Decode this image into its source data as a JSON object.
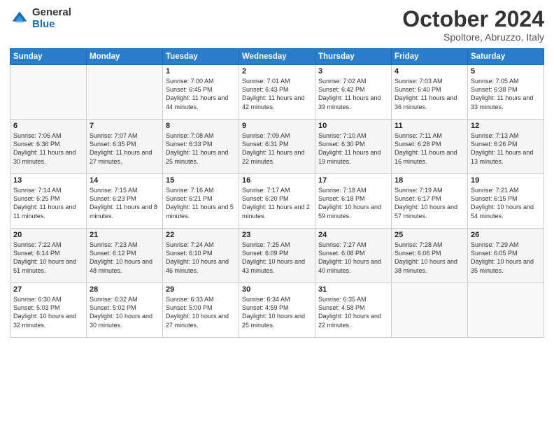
{
  "logo": {
    "general": "General",
    "blue": "Blue"
  },
  "header": {
    "month": "October 2024",
    "location": "Spoltore, Abruzzo, Italy"
  },
  "weekdays": [
    "Sunday",
    "Monday",
    "Tuesday",
    "Wednesday",
    "Thursday",
    "Friday",
    "Saturday"
  ],
  "weeks": [
    [
      {
        "day": "",
        "info": ""
      },
      {
        "day": "",
        "info": ""
      },
      {
        "day": "1",
        "info": "Sunrise: 7:00 AM\nSunset: 6:45 PM\nDaylight: 11 hours and 44 minutes."
      },
      {
        "day": "2",
        "info": "Sunrise: 7:01 AM\nSunset: 6:43 PM\nDaylight: 11 hours and 42 minutes."
      },
      {
        "day": "3",
        "info": "Sunrise: 7:02 AM\nSunset: 6:42 PM\nDaylight: 11 hours and 39 minutes."
      },
      {
        "day": "4",
        "info": "Sunrise: 7:03 AM\nSunset: 6:40 PM\nDaylight: 11 hours and 36 minutes."
      },
      {
        "day": "5",
        "info": "Sunrise: 7:05 AM\nSunset: 6:38 PM\nDaylight: 11 hours and 33 minutes."
      }
    ],
    [
      {
        "day": "6",
        "info": "Sunrise: 7:06 AM\nSunset: 6:36 PM\nDaylight: 11 hours and 30 minutes."
      },
      {
        "day": "7",
        "info": "Sunrise: 7:07 AM\nSunset: 6:35 PM\nDaylight: 11 hours and 27 minutes."
      },
      {
        "day": "8",
        "info": "Sunrise: 7:08 AM\nSunset: 6:33 PM\nDaylight: 11 hours and 25 minutes."
      },
      {
        "day": "9",
        "info": "Sunrise: 7:09 AM\nSunset: 6:31 PM\nDaylight: 11 hours and 22 minutes."
      },
      {
        "day": "10",
        "info": "Sunrise: 7:10 AM\nSunset: 6:30 PM\nDaylight: 11 hours and 19 minutes."
      },
      {
        "day": "11",
        "info": "Sunrise: 7:11 AM\nSunset: 6:28 PM\nDaylight: 11 hours and 16 minutes."
      },
      {
        "day": "12",
        "info": "Sunrise: 7:13 AM\nSunset: 6:26 PM\nDaylight: 11 hours and 13 minutes."
      }
    ],
    [
      {
        "day": "13",
        "info": "Sunrise: 7:14 AM\nSunset: 6:25 PM\nDaylight: 11 hours and 11 minutes."
      },
      {
        "day": "14",
        "info": "Sunrise: 7:15 AM\nSunset: 6:23 PM\nDaylight: 11 hours and 8 minutes."
      },
      {
        "day": "15",
        "info": "Sunrise: 7:16 AM\nSunset: 6:21 PM\nDaylight: 11 hours and 5 minutes."
      },
      {
        "day": "16",
        "info": "Sunrise: 7:17 AM\nSunset: 6:20 PM\nDaylight: 11 hours and 2 minutes."
      },
      {
        "day": "17",
        "info": "Sunrise: 7:18 AM\nSunset: 6:18 PM\nDaylight: 10 hours and 59 minutes."
      },
      {
        "day": "18",
        "info": "Sunrise: 7:19 AM\nSunset: 6:17 PM\nDaylight: 10 hours and 57 minutes."
      },
      {
        "day": "19",
        "info": "Sunrise: 7:21 AM\nSunset: 6:15 PM\nDaylight: 10 hours and 54 minutes."
      }
    ],
    [
      {
        "day": "20",
        "info": "Sunrise: 7:22 AM\nSunset: 6:14 PM\nDaylight: 10 hours and 51 minutes."
      },
      {
        "day": "21",
        "info": "Sunrise: 7:23 AM\nSunset: 6:12 PM\nDaylight: 10 hours and 48 minutes."
      },
      {
        "day": "22",
        "info": "Sunrise: 7:24 AM\nSunset: 6:10 PM\nDaylight: 10 hours and 46 minutes."
      },
      {
        "day": "23",
        "info": "Sunrise: 7:25 AM\nSunset: 6:09 PM\nDaylight: 10 hours and 43 minutes."
      },
      {
        "day": "24",
        "info": "Sunrise: 7:27 AM\nSunset: 6:08 PM\nDaylight: 10 hours and 40 minutes."
      },
      {
        "day": "25",
        "info": "Sunrise: 7:28 AM\nSunset: 6:06 PM\nDaylight: 10 hours and 38 minutes."
      },
      {
        "day": "26",
        "info": "Sunrise: 7:29 AM\nSunset: 6:05 PM\nDaylight: 10 hours and 35 minutes."
      }
    ],
    [
      {
        "day": "27",
        "info": "Sunrise: 6:30 AM\nSunset: 5:03 PM\nDaylight: 10 hours and 32 minutes."
      },
      {
        "day": "28",
        "info": "Sunrise: 6:32 AM\nSunset: 5:02 PM\nDaylight: 10 hours and 30 minutes."
      },
      {
        "day": "29",
        "info": "Sunrise: 6:33 AM\nSunset: 5:00 PM\nDaylight: 10 hours and 27 minutes."
      },
      {
        "day": "30",
        "info": "Sunrise: 6:34 AM\nSunset: 4:59 PM\nDaylight: 10 hours and 25 minutes."
      },
      {
        "day": "31",
        "info": "Sunrise: 6:35 AM\nSunset: 4:58 PM\nDaylight: 10 hours and 22 minutes."
      },
      {
        "day": "",
        "info": ""
      },
      {
        "day": "",
        "info": ""
      }
    ]
  ]
}
